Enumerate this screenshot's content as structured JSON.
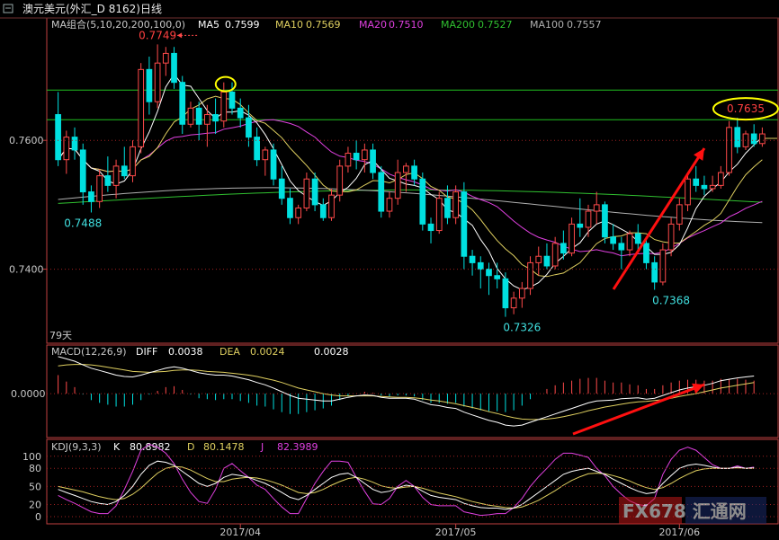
{
  "title": {
    "icon": "chart-window-icon",
    "text": "澳元美元(外汇_D 8162)日线"
  },
  "colors": {
    "up": "#ff4a4a",
    "down": "#00e0e0",
    "ma5": "#ffffff",
    "ma10": "#e0d060",
    "ma20": "#e040e0",
    "ma200": "#30c030",
    "ma100": "#b0b0b0",
    "hline": "#20c020",
    "arrow": "#ff1010",
    "circle": "#ffff00",
    "axis": "#c04040",
    "dashed": "#a02020"
  },
  "ma_legend": {
    "header": "MA组合(5,10,20,200,100,0)",
    "items": [
      {
        "label": "MA5",
        "value": "0.7599",
        "color": "#ffffff"
      },
      {
        "label": "MA10",
        "value": "0.7569",
        "color": "#e0d060"
      },
      {
        "label": "MA20",
        "value": "0.7510",
        "color": "#e040e0"
      },
      {
        "label": "MA200",
        "value": "0.7527",
        "color": "#30c030"
      },
      {
        "label": "MA100",
        "value": "0.7557",
        "color": "#b0b0b0"
      }
    ]
  },
  "macd_legend": {
    "header": "MACD(12,26,9)",
    "diff_label": "DIFF",
    "diff_value": "0.0038",
    "dea_label": "DEA",
    "dea_value": "0.0024",
    "macd_value": "0.0028"
  },
  "kdj_legend": {
    "header": "KDJ(9,3,3)",
    "k_label": "K",
    "k_value": "80.8982",
    "d_label": "D",
    "d_value": "80.1478",
    "j_label": "J",
    "j_value": "82.3989"
  },
  "days_label": "79天",
  "watermark": "FX678 汇通网",
  "chart_data": [
    {
      "type": "candlestick",
      "yticks": [
        "0.7600",
        "0.7400"
      ],
      "ylim": [
        0.7285,
        0.779
      ],
      "annotations": [
        {
          "text": "0.7749",
          "x": 12,
          "y": 0.7749,
          "color": "#ff4040"
        },
        {
          "text": "0.7488",
          "x": 3,
          "y": 0.7488,
          "color": "#40e0e0"
        },
        {
          "text": "0.7326",
          "x": 56,
          "y": 0.7326,
          "color": "#40e0e0"
        },
        {
          "text": "0.7368",
          "x": 74,
          "y": 0.7368,
          "color": "#40e0e0"
        },
        {
          "text": "0.7635",
          "x": 83,
          "y": 0.7635,
          "color": "#ff4040"
        }
      ],
      "hlines": [
        0.7678,
        0.7632
      ],
      "xticks": [
        {
          "x": 22,
          "label": "2017/04"
        },
        {
          "x": 48,
          "label": "2017/05"
        },
        {
          "x": 75,
          "label": "2017/06"
        }
      ],
      "candles": [
        [
          0.764,
          0.7675,
          0.756,
          0.757
        ],
        [
          0.757,
          0.7615,
          0.7548,
          0.7605
        ],
        [
          0.7605,
          0.762,
          0.757,
          0.7585
        ],
        [
          0.7585,
          0.7595,
          0.75,
          0.752
        ],
        [
          0.752,
          0.753,
          0.7488,
          0.7505
        ],
        [
          0.7505,
          0.7555,
          0.7495,
          0.7545
        ],
        [
          0.7545,
          0.7575,
          0.752,
          0.753
        ],
        [
          0.753,
          0.757,
          0.751,
          0.756
        ],
        [
          0.756,
          0.759,
          0.754,
          0.7545
        ],
        [
          0.7545,
          0.76,
          0.7535,
          0.759
        ],
        [
          0.759,
          0.772,
          0.758,
          0.771
        ],
        [
          0.771,
          0.773,
          0.764,
          0.766
        ],
        [
          0.766,
          0.7749,
          0.765,
          0.772
        ],
        [
          0.772,
          0.7745,
          0.77,
          0.7735
        ],
        [
          0.7735,
          0.7745,
          0.768,
          0.769
        ],
        [
          0.769,
          0.77,
          0.761,
          0.7625
        ],
        [
          0.7625,
          0.766,
          0.762,
          0.765
        ],
        [
          0.765,
          0.766,
          0.76,
          0.7625
        ],
        [
          0.7625,
          0.7655,
          0.759,
          0.764
        ],
        [
          0.764,
          0.7665,
          0.761,
          0.763
        ],
        [
          0.763,
          0.769,
          0.762,
          0.7675
        ],
        [
          0.7675,
          0.769,
          0.764,
          0.765
        ],
        [
          0.765,
          0.7665,
          0.762,
          0.7635
        ],
        [
          0.7635,
          0.7655,
          0.759,
          0.7605
        ],
        [
          0.7605,
          0.762,
          0.756,
          0.757
        ],
        [
          0.757,
          0.759,
          0.7545,
          0.7585
        ],
        [
          0.7585,
          0.7595,
          0.753,
          0.754
        ],
        [
          0.754,
          0.756,
          0.75,
          0.751
        ],
        [
          0.751,
          0.7525,
          0.747,
          0.748
        ],
        [
          0.748,
          0.75,
          0.747,
          0.7495
        ],
        [
          0.7495,
          0.755,
          0.749,
          0.754
        ],
        [
          0.754,
          0.755,
          0.749,
          0.75
        ],
        [
          0.75,
          0.751,
          0.7475,
          0.748
        ],
        [
          0.748,
          0.7525,
          0.7475,
          0.7515
        ],
        [
          0.7515,
          0.757,
          0.7505,
          0.756
        ],
        [
          0.756,
          0.759,
          0.755,
          0.758
        ],
        [
          0.758,
          0.76,
          0.7555,
          0.757
        ],
        [
          0.757,
          0.7595,
          0.755,
          0.7585
        ],
        [
          0.7585,
          0.7595,
          0.754,
          0.755
        ],
        [
          0.755,
          0.756,
          0.748,
          0.749
        ],
        [
          0.749,
          0.752,
          0.748,
          0.751
        ],
        [
          0.751,
          0.757,
          0.75,
          0.755
        ],
        [
          0.755,
          0.7565,
          0.752,
          0.756
        ],
        [
          0.756,
          0.757,
          0.753,
          0.754
        ],
        [
          0.754,
          0.755,
          0.746,
          0.747
        ],
        [
          0.747,
          0.748,
          0.744,
          0.746
        ],
        [
          0.746,
          0.752,
          0.7455,
          0.751
        ],
        [
          0.751,
          0.753,
          0.747,
          0.748
        ],
        [
          0.748,
          0.753,
          0.747,
          0.752
        ],
        [
          0.752,
          0.7535,
          0.74,
          0.742
        ],
        [
          0.742,
          0.743,
          0.739,
          0.741
        ],
        [
          0.741,
          0.742,
          0.737,
          0.74
        ],
        [
          0.74,
          0.741,
          0.736,
          0.739
        ],
        [
          0.739,
          0.741,
          0.737,
          0.7385
        ],
        [
          0.7385,
          0.7395,
          0.7326,
          0.734
        ],
        [
          0.734,
          0.7365,
          0.733,
          0.7355
        ],
        [
          0.7355,
          0.738,
          0.734,
          0.737
        ],
        [
          0.737,
          0.742,
          0.736,
          0.741
        ],
        [
          0.741,
          0.7435,
          0.739,
          0.742
        ],
        [
          0.742,
          0.744,
          0.74,
          0.7405
        ],
        [
          0.7405,
          0.745,
          0.74,
          0.744
        ],
        [
          0.744,
          0.746,
          0.7415,
          0.7425
        ],
        [
          0.7425,
          0.748,
          0.742,
          0.747
        ],
        [
          0.747,
          0.751,
          0.745,
          0.7465
        ],
        [
          0.7465,
          0.75,
          0.745,
          0.749
        ],
        [
          0.749,
          0.752,
          0.747,
          0.75
        ],
        [
          0.75,
          0.7505,
          0.744,
          0.745
        ],
        [
          0.745,
          0.747,
          0.743,
          0.744
        ],
        [
          0.744,
          0.745,
          0.74,
          0.743
        ],
        [
          0.743,
          0.746,
          0.742,
          0.7455
        ],
        [
          0.7455,
          0.747,
          0.743,
          0.744
        ],
        [
          0.744,
          0.745,
          0.74,
          0.741
        ],
        [
          0.741,
          0.742,
          0.7368,
          0.738
        ],
        [
          0.738,
          0.744,
          0.7375,
          0.743
        ],
        [
          0.743,
          0.748,
          0.742,
          0.747
        ],
        [
          0.747,
          0.751,
          0.746,
          0.75
        ],
        [
          0.75,
          0.755,
          0.749,
          0.754
        ],
        [
          0.754,
          0.756,
          0.752,
          0.753
        ],
        [
          0.753,
          0.7545,
          0.7515,
          0.7525
        ],
        [
          0.7525,
          0.7545,
          0.752,
          0.753
        ],
        [
          0.753,
          0.756,
          0.7525,
          0.755
        ],
        [
          0.755,
          0.763,
          0.7545,
          0.762
        ],
        [
          0.762,
          0.7635,
          0.758,
          0.759
        ],
        [
          0.759,
          0.7615,
          0.7585,
          0.761
        ],
        [
          0.761,
          0.7625,
          0.759,
          0.7595
        ],
        [
          0.7595,
          0.762,
          0.759,
          0.761
        ]
      ]
    },
    {
      "type": "line",
      "panel": "MACD",
      "yticks": [
        "0.0000"
      ],
      "series": [
        {
          "name": "DIFF",
          "values": [
            0.008,
            0.0075,
            0.007,
            0.0062,
            0.0055,
            0.005,
            0.0045,
            0.004,
            0.0037,
            0.0036,
            0.004,
            0.0045,
            0.005,
            0.0055,
            0.0058,
            0.0055,
            0.005,
            0.0045,
            0.0042,
            0.004,
            0.004,
            0.0038,
            0.0034,
            0.003,
            0.0024,
            0.0019,
            0.0012,
            0.0004,
            -0.0004,
            -0.001,
            -0.0012,
            -0.0014,
            -0.0016,
            -0.0016,
            -0.0012,
            -0.0008,
            -0.0005,
            -0.0003,
            -0.0004,
            -0.0008,
            -0.001,
            -0.001,
            -0.001,
            -0.0012,
            -0.0018,
            -0.0024,
            -0.0026,
            -0.003,
            -0.0032,
            -0.004,
            -0.0046,
            -0.0052,
            -0.0058,
            -0.0062,
            -0.0068,
            -0.007,
            -0.0068,
            -0.0062,
            -0.0056,
            -0.005,
            -0.0044,
            -0.0038,
            -0.0032,
            -0.0026,
            -0.002,
            -0.0016,
            -0.0015,
            -0.0014,
            -0.0011,
            -0.001,
            -0.0009,
            -0.0012,
            -0.001,
            -0.0004,
            0.0002,
            0.0008,
            0.0012,
            0.0015,
            0.0018,
            0.0022,
            0.0028,
            0.0031,
            0.0034,
            0.0036,
            0.0038
          ]
        },
        {
          "name": "DEA",
          "values": [
            0.006,
            0.0062,
            0.0063,
            0.0063,
            0.0062,
            0.006,
            0.0057,
            0.0054,
            0.0051,
            0.0048,
            0.0047,
            0.0046,
            0.0047,
            0.0048,
            0.005,
            0.0051,
            0.0051,
            0.005,
            0.0048,
            0.0047,
            0.0046,
            0.0044,
            0.0042,
            0.004,
            0.0037,
            0.0033,
            0.0029,
            0.0024,
            0.0018,
            0.0012,
            0.0008,
            0.0004,
            0.0,
            -0.0003,
            -0.0005,
            -0.0005,
            -0.0005,
            -0.0005,
            -0.0005,
            -0.0006,
            -0.0007,
            -0.0008,
            -0.0008,
            -0.0009,
            -0.0011,
            -0.0014,
            -0.0016,
            -0.0019,
            -0.0022,
            -0.0026,
            -0.003,
            -0.0034,
            -0.0039,
            -0.0043,
            -0.0048,
            -0.0052,
            -0.0055,
            -0.0056,
            -0.0056,
            -0.0055,
            -0.0053,
            -0.005,
            -0.0046,
            -0.0042,
            -0.0037,
            -0.0033,
            -0.0029,
            -0.0026,
            -0.0023,
            -0.002,
            -0.0018,
            -0.0017,
            -0.0015,
            -0.0013,
            -0.001,
            -0.0006,
            -0.0003,
            0.0,
            0.0004,
            0.0008,
            0.0012,
            0.0015,
            0.0018,
            0.0021,
            0.0024
          ]
        }
      ]
    },
    {
      "type": "line",
      "panel": "KDJ",
      "yticks": [
        "100",
        "80",
        "50",
        "20",
        "0"
      ],
      "series": [
        {
          "name": "K",
          "values": [
            45,
            40,
            35,
            30,
            25,
            22,
            20,
            25,
            35,
            50,
            70,
            85,
            92,
            90,
            85,
            75,
            65,
            55,
            50,
            55,
            65,
            70,
            68,
            65,
            60,
            55,
            48,
            40,
            32,
            28,
            35,
            45,
            55,
            65,
            70,
            72,
            65,
            55,
            45,
            40,
            42,
            48,
            52,
            50,
            42,
            35,
            32,
            30,
            28,
            22,
            18,
            15,
            14,
            14,
            12,
            14,
            20,
            30,
            40,
            50,
            60,
            70,
            75,
            78,
            80,
            75,
            70,
            62,
            55,
            48,
            42,
            38,
            40,
            55,
            68,
            80,
            85,
            87,
            85,
            82,
            80,
            80,
            82,
            80,
            81
          ]
        },
        {
          "name": "D",
          "values": [
            50,
            47,
            44,
            41,
            37,
            33,
            30,
            28,
            30,
            37,
            47,
            60,
            72,
            80,
            83,
            82,
            77,
            70,
            63,
            58,
            58,
            62,
            64,
            65,
            64,
            61,
            57,
            52,
            46,
            40,
            38,
            40,
            45,
            52,
            58,
            63,
            65,
            62,
            57,
            51,
            48,
            47,
            49,
            50,
            47,
            43,
            39,
            36,
            33,
            29,
            25,
            22,
            19,
            17,
            15,
            14,
            16,
            21,
            27,
            35,
            43,
            52,
            60,
            66,
            71,
            72,
            71,
            68,
            64,
            59,
            53,
            48,
            45,
            48,
            55,
            63,
            70,
            76,
            79,
            80,
            80,
            80,
            81,
            80,
            80
          ]
        },
        {
          "name": "J",
          "values": [
            35,
            28,
            22,
            15,
            8,
            5,
            5,
            18,
            45,
            75,
            110,
            120,
            115,
            105,
            88,
            62,
            40,
            25,
            22,
            45,
            80,
            88,
            76,
            65,
            52,
            45,
            30,
            16,
            5,
            5,
            30,
            55,
            75,
            92,
            92,
            90,
            65,
            42,
            21,
            20,
            30,
            50,
            60,
            50,
            32,
            20,
            18,
            18,
            18,
            8,
            5,
            2,
            3,
            5,
            5,
            15,
            30,
            50,
            66,
            80,
            95,
            105,
            105,
            102,
            98,
            80,
            68,
            50,
            37,
            26,
            20,
            18,
            30,
            70,
            95,
            110,
            115,
            110,
            98,
            86,
            80,
            80,
            84,
            80,
            82
          ]
        }
      ]
    }
  ]
}
